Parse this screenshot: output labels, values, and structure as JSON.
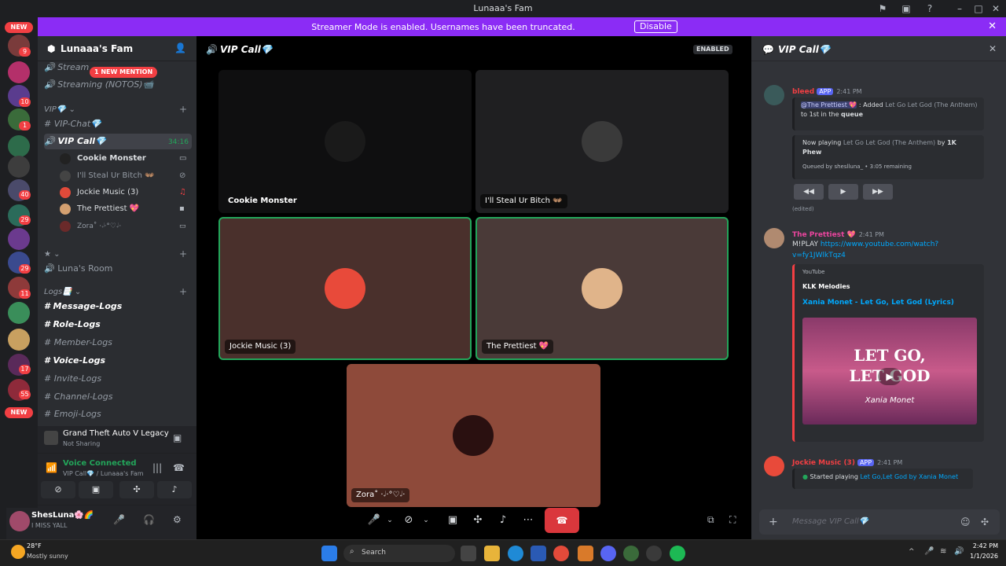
{
  "window": {
    "title": "Lunaaa's Fam"
  },
  "banner": {
    "text": "Streamer Mode is enabled. Usernames have been truncated.",
    "button": "Disable"
  },
  "guilds": {
    "new_top": "NEW",
    "new_bottom": "NEW",
    "badges": [
      "9",
      "10",
      "1",
      "40",
      "29",
      "29",
      "11",
      "17",
      "55"
    ]
  },
  "server": {
    "name": "Lunaaa's Fam"
  },
  "channels": {
    "mention_pill": "1 NEW MENTION",
    "stream_notos": "Streaming (NOTOS)📹",
    "cat_vip": "VIP💎",
    "vip_chat": "VIP-Chat💎",
    "vip_call": "VIP Call💎",
    "vip_call_time": "34:16",
    "voice_users": [
      "Cookie Monster",
      "I'll Steal Ur Bitch 👐🏽",
      "Jockie Music (3)",
      "The Prettiest 💖",
      "Zora˚ ·𝆹𝅥·°♡𝆹𝅥·"
    ],
    "cat_star": "★",
    "lunas_room": "Luna's Room",
    "cat_logs": "Logs📑",
    "logs": [
      "Message-Logs",
      "Role-Logs",
      "Member-Logs",
      "Voice-Logs",
      "Invite-Logs",
      "Channel-Logs",
      "Emoji-Logs"
    ]
  },
  "panel": {
    "game": "Grand Theft Auto V Legacy",
    "game_status": "Not Sharing",
    "voice": "Voice Connected",
    "voice_channel": "VIP Call💎 / Lunaaa's Fam",
    "user": "ShesLuna🌸🌈",
    "user_status": "I MISS YALL"
  },
  "stage": {
    "title": "VIP Call💎",
    "badge": "ENABLED",
    "tiles": [
      "Cookie Monster",
      "I'll Steal Ur Bitch 👐🏽",
      "Jockie Music (3)",
      "The Prettiest 💖",
      "Zora˚ ·𝆹𝅥·°♡𝆹𝅥·"
    ]
  },
  "chat": {
    "title": "VIP Call💎",
    "m1": {
      "author": "bleed",
      "app": "APP",
      "time": "2:41 PM",
      "mention": "@The Prettiest 💖",
      "added": ": Added",
      "song": "Let Go Let God (The Anthem)",
      "to": "to",
      "pos": "1st",
      "in": "in the",
      "queue": "queue",
      "now": "Now playing",
      "np_song": "Let Go Let God (The Anthem)",
      "by": "by",
      "artist": "1K Phew",
      "queued": "Queued by sheslluna_ • 3:05 remaining",
      "edited": "(edited)"
    },
    "m2": {
      "author": "The Prettiest 💖",
      "time": "2:41 PM",
      "cmd": "M!PLAY",
      "url": "https://www.youtube.com/watch?v=fy1JWlkTqz4",
      "provider": "YouTube",
      "channel": "KLK Melodies",
      "video": "Xania Monet - Let Go, Let God (Lyrics)",
      "thumb_line1": "LET GO,",
      "thumb_line2": "LET GOD",
      "thumb_artist": "Xania Monet"
    },
    "m3": {
      "author": "Jockie Music (3)",
      "app": "APP",
      "time": "2:41 PM",
      "started": "Started playing",
      "song": "Let Go,Let God by Xania Monet"
    },
    "placeholder": "Message VIP Call💎"
  },
  "taskbar": {
    "temp": "28°F",
    "weather": "Mostly sunny",
    "search": "Search",
    "time": "2:42 PM",
    "date": "1/1/2026"
  }
}
